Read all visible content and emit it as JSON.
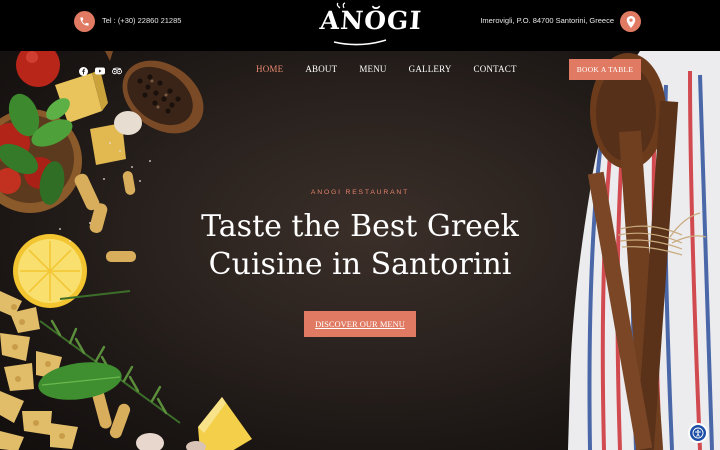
{
  "topbar": {
    "phone": "Tel : (+30) 22860 21285",
    "address": "Imerovigli, P.O. 84700 Santorini, Greece",
    "phone_icon": "phone-icon",
    "location_icon": "map-pin-icon"
  },
  "logo": {
    "text": "ANŎGI"
  },
  "social": [
    {
      "icon": "facebook-icon"
    },
    {
      "icon": "youtube-icon"
    },
    {
      "icon": "tripadvisor-icon"
    }
  ],
  "nav": {
    "items": [
      {
        "label": "HOME",
        "active": true
      },
      {
        "label": "ABOUT"
      },
      {
        "label": "MENU"
      },
      {
        "label": "GALLERY"
      },
      {
        "label": "CONTACT"
      }
    ],
    "book_label": "BOOK A TABLE"
  },
  "hero": {
    "eyebrow": "ANOGI RESTAURANT",
    "headline_line1": "Taste the Best Greek",
    "headline_line2": "Cuisine in Santorini",
    "cta_label": "DISCOVER OUR MENU"
  },
  "accessibility": {
    "icon": "accessibility-icon"
  },
  "colors": {
    "accent": "#e07a63",
    "topbar_bg": "#000000",
    "hero_bg": "#2b231f",
    "a11y_blue": "#1d4fa8"
  }
}
